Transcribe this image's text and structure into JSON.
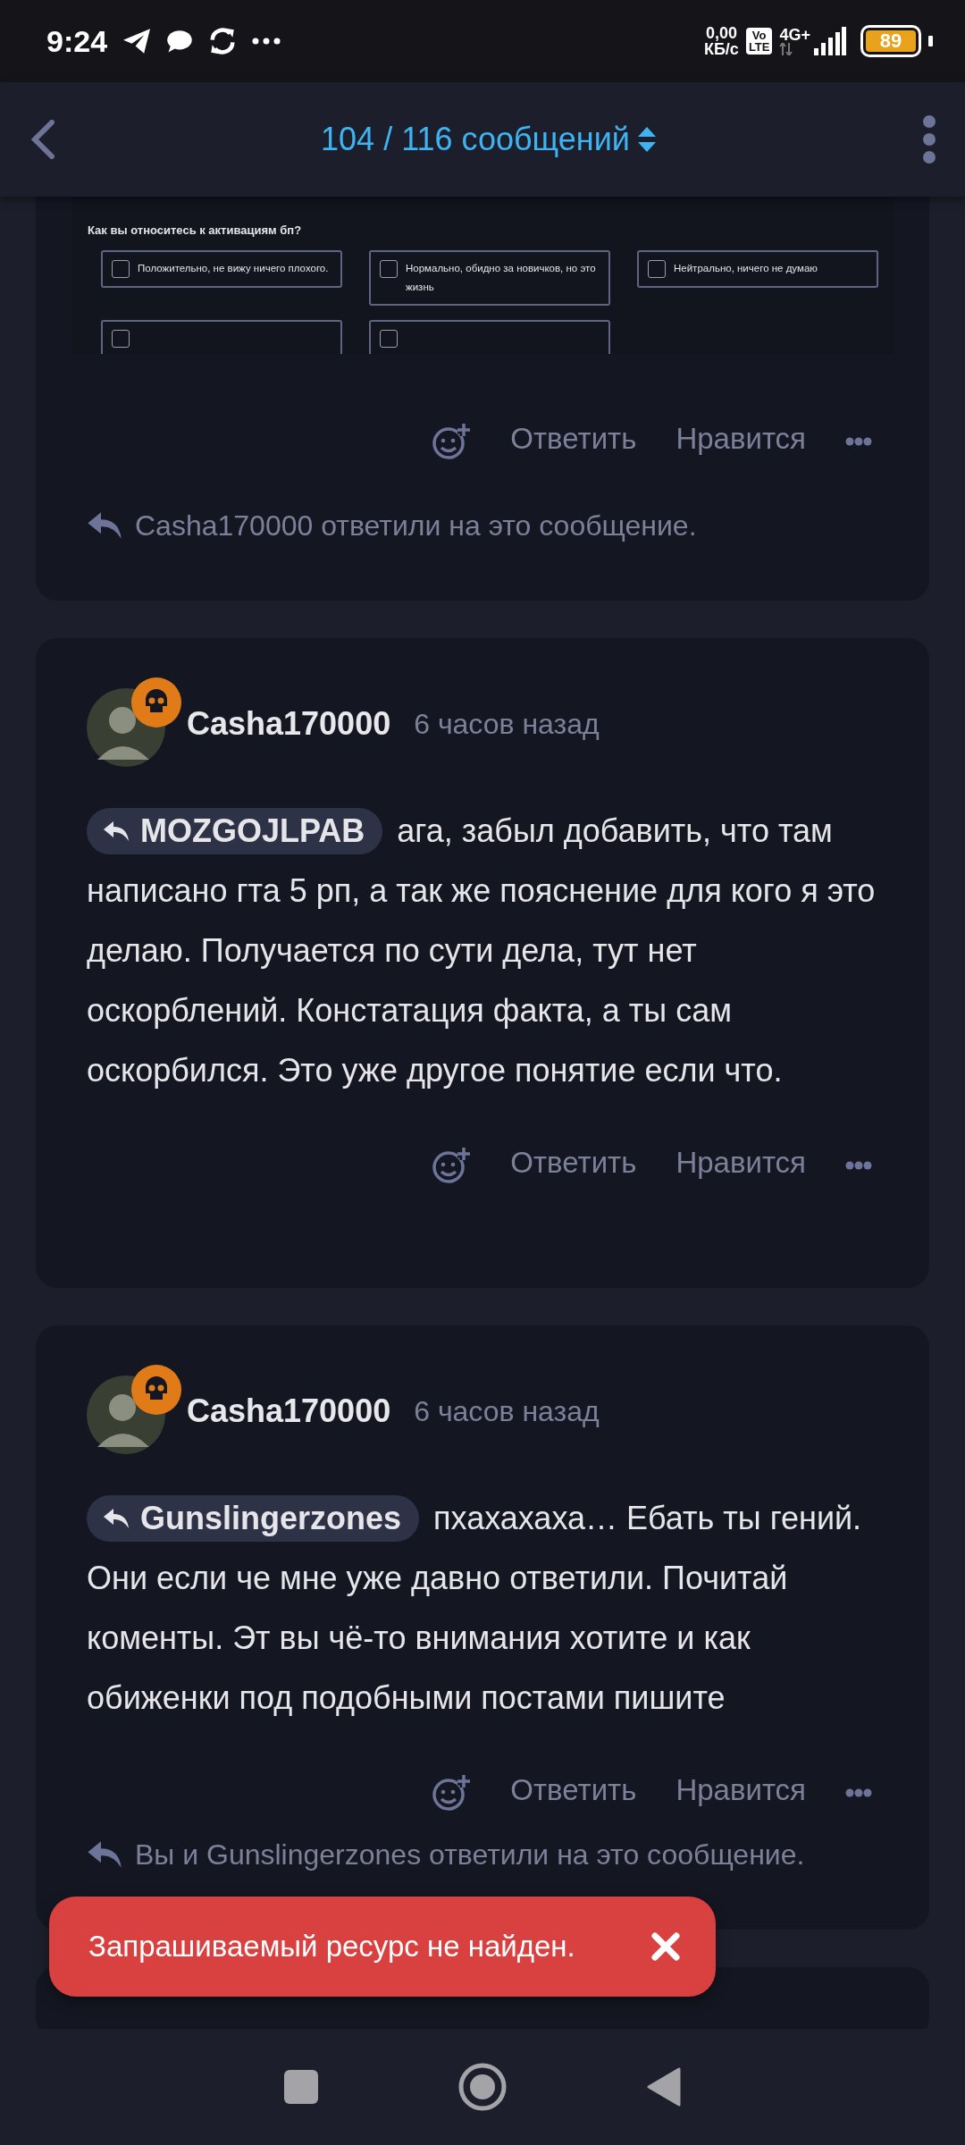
{
  "status_bar": {
    "time": "9:24",
    "net_speed": "0,00",
    "net_unit": "КБ/с",
    "volte_top": "Vo",
    "volte_bottom": "LTE",
    "network": "4G+",
    "battery": "89"
  },
  "header": {
    "title": "104 / 116 сообщений"
  },
  "posts": [
    {
      "embed": {
        "question": "Как вы относитесь к активациям бп?",
        "options": [
          {
            "label": "Положительно, не вижу ничего плохого.",
            "checked": false
          },
          {
            "label": "Нормально, обидно за новичков, но это жизнь",
            "checked": false
          },
          {
            "label": "Нейтрально, ничего не думаю",
            "checked": false
          },
          {
            "checked": false
          },
          {
            "checked": false
          }
        ]
      },
      "actions": [
        "Ответить",
        "Нравится"
      ],
      "reply_note": "Casha170000 ответили на это сообщение."
    },
    {
      "author": "Casha170000",
      "time": "6 часов назад",
      "quote": "MOZGOJLPAB",
      "text": "ага, забыл добавить, что там написано гта 5 рп, а так же пояснение для кого я это делаю. Получается по сути дела, тут нет оскорблений. Констатация факта, а ты сам оскорбился. Это уже другое понятие если что.",
      "actions": [
        "Ответить",
        "Нравится"
      ]
    },
    {
      "author": "Casha170000",
      "time": "6 часов назад",
      "quote": "Gunslingerzones",
      "text": "пхахахаха… Ебать ты гений. Они если че мне уже давно ответили. Почитай коменты. Эт вы чё-то внимания хотите и как обиженки под подобными постами пишите",
      "actions": [
        "Ответить",
        "Нравится"
      ],
      "reply_note": "Вы и Gunslingerzones ответили на это сообщение."
    },
    {
      "kind": "cut"
    }
  ],
  "toast": {
    "message": "Запрашиваемый ресурс не найден."
  }
}
